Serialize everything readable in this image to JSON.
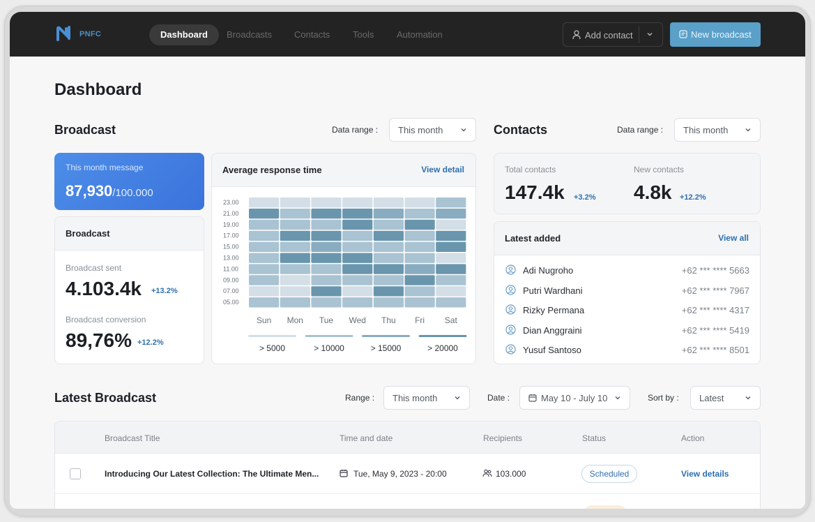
{
  "nav": {
    "brand": "PNFC",
    "links": [
      "Dashboard",
      "Broadcasts",
      "Contacts",
      "Tools",
      "Automation"
    ],
    "add_contact": "Add contact",
    "new_broadcast": "New broadcast"
  },
  "page": {
    "title": "Dashboard"
  },
  "broadcast_section": {
    "title": "Broadcast",
    "range_label": "Data range :",
    "range_value": "This month",
    "month_card": {
      "label": "This month message",
      "value": "87,930",
      "limit": "/100.000"
    },
    "stats_card": {
      "title": "Broadcast",
      "sent_label": "Broadcast sent",
      "sent_value": "4.103.4k",
      "sent_delta": "+13.2%",
      "conv_label": "Broadcast conversion",
      "conv_value": "89,76%",
      "conv_delta": "+12.2%"
    },
    "heatmap": {
      "title": "Average response time",
      "link": "View detail",
      "hours": [
        "23.00",
        "21.00",
        "19.00",
        "17.00",
        "15.00",
        "13.00",
        "11.00",
        "09.00",
        "07.00",
        "05.00"
      ],
      "days": [
        "Sun",
        "Mon",
        "Tue",
        "Wed",
        "Thu",
        "Fri",
        "Sat"
      ],
      "levels": [
        [
          0,
          0,
          0,
          0,
          0,
          0,
          1
        ],
        [
          3,
          1,
          3,
          3,
          2,
          1,
          2
        ],
        [
          1,
          1,
          1,
          3,
          1,
          3,
          0
        ],
        [
          1,
          3,
          3,
          1,
          3,
          1,
          3
        ],
        [
          1,
          1,
          2,
          1,
          1,
          1,
          3
        ],
        [
          1,
          3,
          3,
          3,
          1,
          1,
          0
        ],
        [
          1,
          1,
          1,
          3,
          3,
          2,
          3
        ],
        [
          1,
          0,
          1,
          1,
          1,
          3,
          1
        ],
        [
          0,
          0,
          3,
          0,
          3,
          1,
          0
        ],
        [
          1,
          1,
          1,
          1,
          1,
          1,
          1
        ]
      ],
      "legend": [
        "> 5000",
        "> 10000",
        "> 15000",
        "> 20000"
      ],
      "colors": [
        "#d3dee6",
        "#a9c3d2",
        "#89acc0",
        "#6a96ad"
      ]
    }
  },
  "contacts_section": {
    "title": "Contacts",
    "range_label": "Data range :",
    "range_value": "This month",
    "total_label": "Total contacts",
    "total_value": "147.4k",
    "total_delta": "+3.2%",
    "new_label": "New contacts",
    "new_value": "4.8k",
    "new_delta": "+12.2%",
    "latest_title": "Latest added",
    "latest_link": "View all",
    "people": [
      {
        "name": "Adi Nugroho",
        "phone": "+62 *** **** 5663"
      },
      {
        "name": "Putri Wardhani",
        "phone": "+62 *** **** 7967"
      },
      {
        "name": "Rizky Permana",
        "phone": "+62 *** **** 4317"
      },
      {
        "name": "Dian Anggraini",
        "phone": "+62 *** **** 5419"
      },
      {
        "name": "Yusuf Santoso",
        "phone": "+62 *** **** 8501"
      }
    ]
  },
  "latest_broadcast": {
    "title": "Latest Broadcast",
    "range_label": "Range :",
    "range_value": "This month",
    "date_label": "Date :",
    "date_value": "May 10 - July 10",
    "sort_label": "Sort by :",
    "sort_value": "Latest",
    "columns": [
      "Broadcast Title",
      "Time and date",
      "Recipients",
      "Status",
      "Action"
    ],
    "rows": [
      {
        "title": "Introducing Our Latest Collection: The Ultimate Men...",
        "date": "Tue, May 9, 2023 - 20:00",
        "recipients": "103.000",
        "status": "Scheduled",
        "action": "View details"
      }
    ]
  }
}
